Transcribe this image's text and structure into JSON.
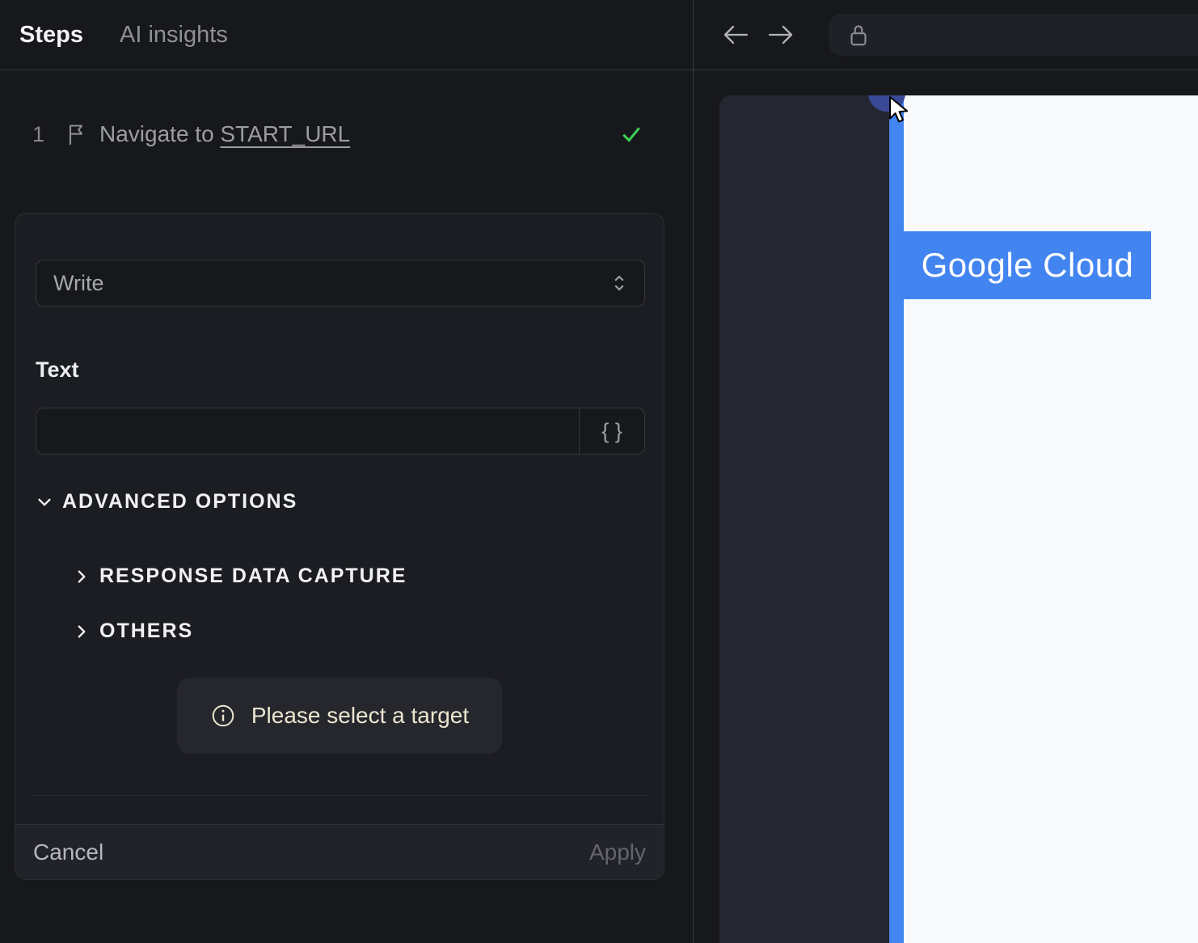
{
  "left_panel": {
    "tabs": [
      {
        "label": "Steps"
      },
      {
        "label": "AI insights"
      }
    ],
    "step": {
      "number": "1",
      "title_prefix": "Navigate to",
      "title_link": "START_URL",
      "status": "success"
    },
    "editor": {
      "action_select": {
        "value": "Write"
      },
      "text_field": {
        "label": "Text",
        "value": "",
        "variable_button": "{ }"
      },
      "advanced_options_label": "ADVANCED OPTIONS",
      "sections": [
        {
          "label": "RESPONSE DATA CAPTURE"
        },
        {
          "label": "OTHERS"
        }
      ],
      "notice": {
        "text": "Please select a target"
      },
      "footer": {
        "cancel_label": "Cancel",
        "apply_label": "Apply"
      }
    }
  },
  "browser": {
    "url_bar": {
      "value": ""
    },
    "page": {
      "highlight_label": "Google Cloud"
    }
  },
  "colors": {
    "highlight_blue": "#4385f0",
    "check_green": "#3bd355",
    "notice_cream": "#ece5d0",
    "page_white": "#f8f9fa",
    "preview_navy": "#242631",
    "app_background": "#17181c",
    "selection_marker_blue": "#3a4896"
  }
}
